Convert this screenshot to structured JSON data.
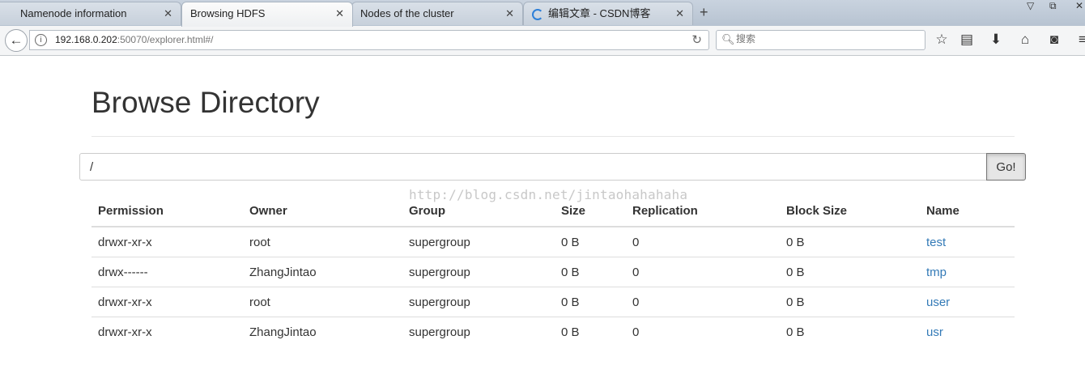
{
  "browser": {
    "tabs": [
      {
        "title": "Namenode information",
        "active": false
      },
      {
        "title": "Browsing HDFS",
        "active": true
      },
      {
        "title": "Nodes of the cluster",
        "active": false
      },
      {
        "title": "编辑文章 - CSDN博客",
        "active": false
      }
    ],
    "url_host": "192.168.0.202",
    "url_rest": ":50070/explorer.html#/",
    "search_placeholder": "搜索"
  },
  "page": {
    "title": "Browse Directory",
    "path_value": "/",
    "go_label": "Go!",
    "watermark": "http://blog.csdn.net/jintaohahahaha"
  },
  "table": {
    "headers": [
      "Permission",
      "Owner",
      "Group",
      "Size",
      "Replication",
      "Block Size",
      "Name"
    ],
    "rows": [
      {
        "permission": "drwxr-xr-x",
        "owner": "root",
        "group": "supergroup",
        "size": "0 B",
        "replication": "0",
        "block_size": "0 B",
        "name": "test"
      },
      {
        "permission": "drwx------",
        "owner": "ZhangJintao",
        "group": "supergroup",
        "size": "0 B",
        "replication": "0",
        "block_size": "0 B",
        "name": "tmp"
      },
      {
        "permission": "drwxr-xr-x",
        "owner": "root",
        "group": "supergroup",
        "size": "0 B",
        "replication": "0",
        "block_size": "0 B",
        "name": "user"
      },
      {
        "permission": "drwxr-xr-x",
        "owner": "ZhangJintao",
        "group": "supergroup",
        "size": "0 B",
        "replication": "0",
        "block_size": "0 B",
        "name": "usr"
      }
    ]
  },
  "colors": {
    "link": "#337ab7",
    "text": "#333333"
  }
}
